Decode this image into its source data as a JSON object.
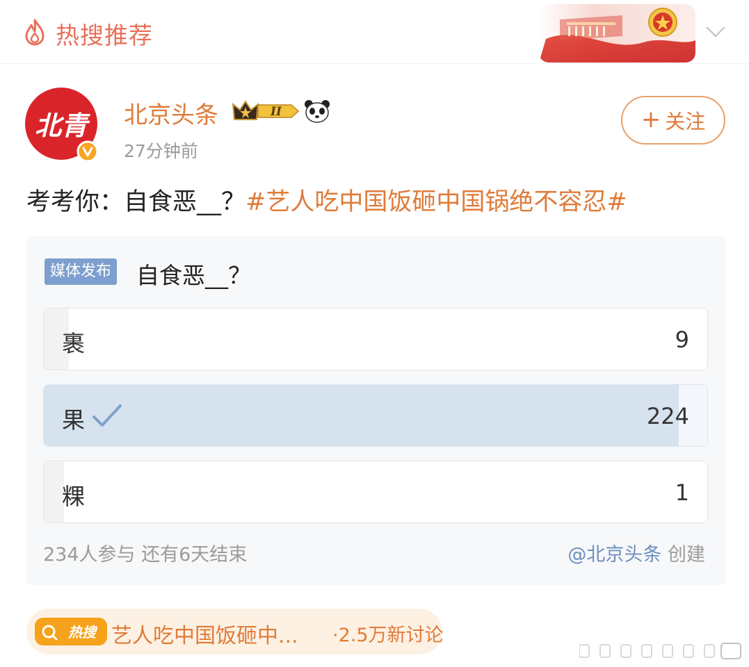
{
  "topbar": {
    "title": "热搜推荐",
    "flame_icon": "flame-icon",
    "dropdown_icon": "chevron-down-icon"
  },
  "author": {
    "name": "北京头条",
    "time": "27分钟前",
    "avatar_text": "北青",
    "crown_badge_text": "II",
    "follow_label": "关注"
  },
  "post": {
    "prefix": "考考你：自食恶__？",
    "hashtag": "#艺人吃中国饭砸中国锅绝不容忍#"
  },
  "poll": {
    "badge": "媒体发布",
    "title": "自食恶__？",
    "options": [
      {
        "label": "裹",
        "count": "9",
        "share": 0.038,
        "selected": false
      },
      {
        "label": "果",
        "count": "224",
        "share": 0.957,
        "selected": true
      },
      {
        "label": "粿",
        "count": "1",
        "share": 0.004,
        "selected": false
      }
    ],
    "stats": "234人参与  还有6天结束",
    "creator_mention": "@北京头条",
    "creator_suffix": " 创建"
  },
  "hot": {
    "icon_text": "热搜",
    "topic": "艺人吃中国饭砸中...",
    "discussion": "·2.5万新讨论"
  },
  "colors": {
    "accent_orange": "#e07b39",
    "badge_blue": "#7d9fcf",
    "selected_fill": "#d7e2ef"
  }
}
